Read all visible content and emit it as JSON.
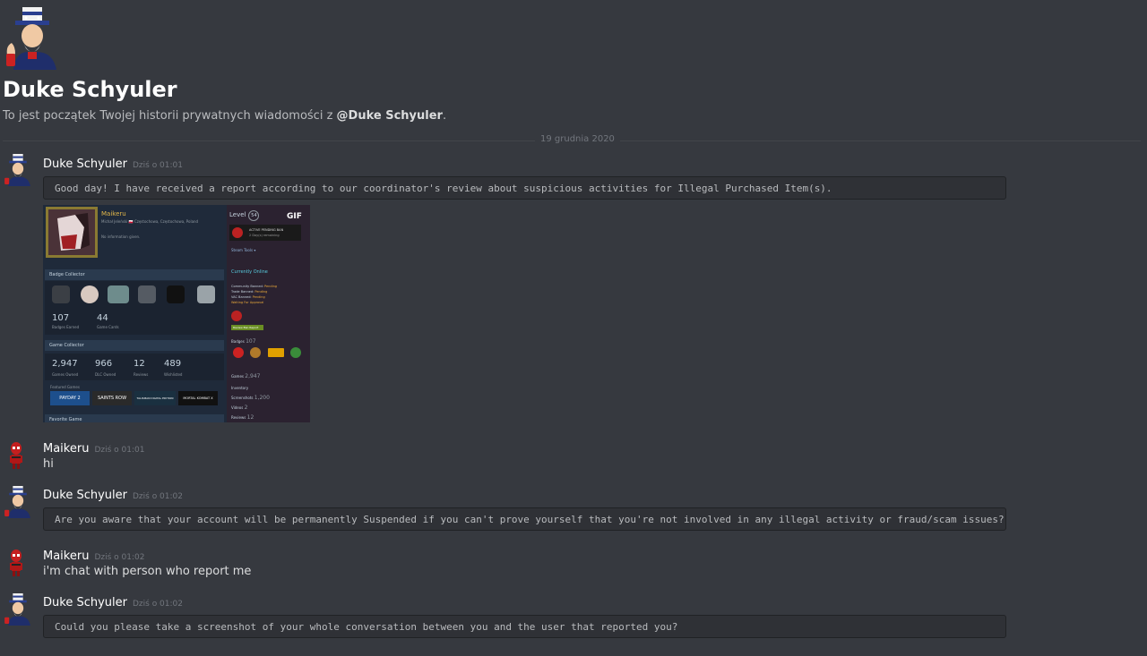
{
  "header": {
    "title": "Duke Schyuler",
    "intro_prefix": "To jest początek Twojej historii prywatnych wiadomości z ",
    "intro_user": "@Duke Schyuler",
    "intro_suffix": "."
  },
  "divider": {
    "date": "19 grudnia 2020"
  },
  "messages": [
    {
      "author": "Duke Schyuler",
      "time": "Dziś o 01:01",
      "code": "Good day! I have received a report according to our coordinator's review about suspicious activities for Illegal Purchased Item(s)."
    },
    {
      "author": "Maikeru",
      "time": "Dziś o 01:01",
      "text": "hi"
    },
    {
      "author": "Duke Schyuler",
      "time": "Dziś o 01:02",
      "code": "Are you aware that your account will be permanently Suspended if you can't prove yourself that you're not involved in any illegal activity or fraud/scam issues?"
    },
    {
      "author": "Maikeru",
      "time": "Dziś o 01:02",
      "text": "i'm chat with person who report me"
    },
    {
      "author": "Duke Schyuler",
      "time": "Dziś o 01:02",
      "code": "Could you please take a screenshot of your whole conversation between you and the user that reported you?"
    }
  ],
  "embed": {
    "profile_name": "Maikeru",
    "profile_location": "Michał Jeleński 🇵🇱 Częstochowa, Częstochowa, Poland",
    "profile_info": "No information given.",
    "badge_collector": "Badge Collector",
    "badges_earned": "107",
    "badges_earned_label": "Badges Earned",
    "game_cards": "44",
    "game_cards_label": "Game Cards",
    "game_collector": "Game Collector",
    "games_owned": "2,947",
    "games_owned_label": "Games Owned",
    "dlc_owned": "966",
    "dlc_owned_label": "DLC Owned",
    "reviews": "12",
    "reviews_label": "Reviews",
    "wishlisted": "489",
    "wishlisted_label": "Wishlisted",
    "featured_games": "Featured Games",
    "games": [
      "PAYDAY 2",
      "SAINTS ROW",
      "TALISMAN DIGITAL EDITION",
      "MORTAL KOMBAT X"
    ],
    "favorite_game": "Favorite Game",
    "level_label": "Level",
    "level": "54",
    "gif_label": "GIF",
    "ban_title": "ACTIVE PENDING BAN",
    "ban_sub": "2 Day(s) remaining",
    "steam_tools": "Steam Tools ▾",
    "currently_online": "Currently Online",
    "status_rows": [
      {
        "label": "Community Banned:",
        "value": "Pending"
      },
      {
        "label": "Trade Banned:",
        "value": "Pending"
      },
      {
        "label": "VAC Banned:",
        "value": "Pending"
      },
      {
        "label": "Waiting For Approval",
        "value": ""
      }
    ],
    "review_button": "Review Ban Report",
    "badges_side": "Badges",
    "badges_side_count": "107",
    "games_side": "Games",
    "games_side_count": "2,947",
    "inventory_side": "Inventory",
    "screenshots_side": "Screenshots",
    "screenshots_count": "1,200",
    "videos_side": "Videos",
    "videos_count": "2",
    "reviews_side": "Reviews",
    "reviews_count": "12"
  }
}
